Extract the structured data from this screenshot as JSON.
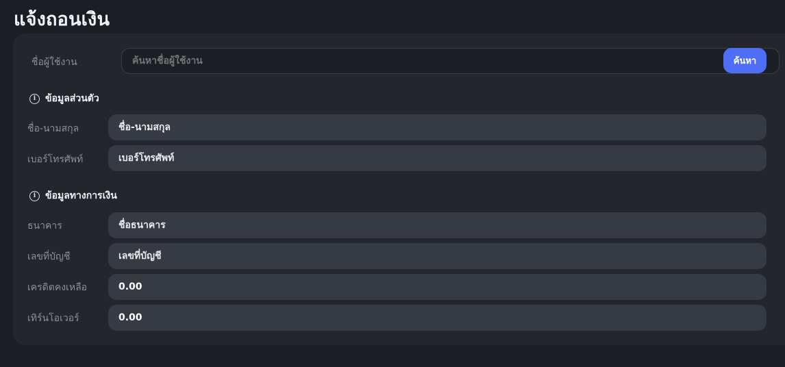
{
  "page": {
    "title": "แจ้งถอนเงิน"
  },
  "search": {
    "label": "ชื่อผู้ใช้งาน",
    "placeholder": "ค้นหาชื่อผู้ใช้งาน",
    "button_label": "ค้นหา"
  },
  "personal": {
    "heading": "ข้อมูลส่วนตัว",
    "icon": "info-icon",
    "fields": [
      {
        "label": "ชื่อ-นามสกุล",
        "value": "ชื่อ-นามสกุล"
      },
      {
        "label": "เบอร์โทรศัพท์",
        "value": "เบอร์โทรศัพท์"
      }
    ]
  },
  "financial": {
    "heading": "ข้อมูลทางการเงิน",
    "icon": "info-icon",
    "fields": [
      {
        "label": "ธนาคาร",
        "value": "ชื่อธนาคาร"
      },
      {
        "label": "เลขที่บัญชี",
        "value": "เลขที่บัญชี"
      },
      {
        "label": "เครดิตคงเหลือ",
        "value": "0.00"
      },
      {
        "label": "เทิร์นโอเวอร์",
        "value": "0.00"
      }
    ]
  },
  "colors": {
    "accent": "#4f6ef7",
    "background": "#1b1e24",
    "card": "#23262d",
    "field": "#363a42"
  }
}
